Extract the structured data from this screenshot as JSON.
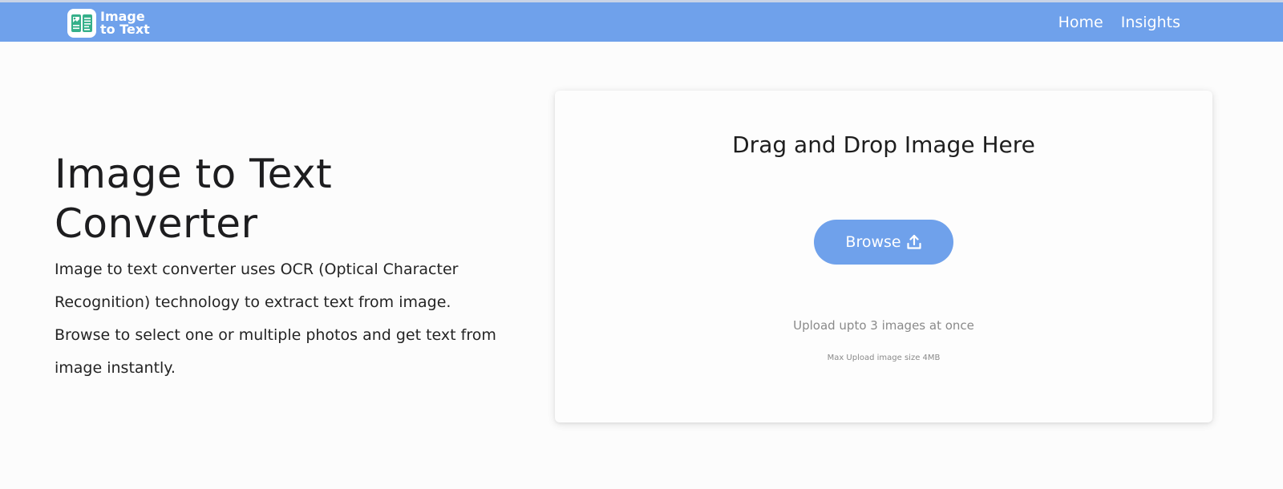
{
  "brand": {
    "line1": "Image",
    "line2": "to Text",
    "accent_color": "#6fa1eb",
    "logo_icon": "image-text-logo-icon"
  },
  "nav": {
    "links": [
      "Home",
      "Insights"
    ]
  },
  "hero": {
    "title": "Image to Text Converter",
    "description": "Image to text converter uses OCR (Optical Character Recognition) technology to extract text from image. Browse to select one or multiple photos and get text from image instantly."
  },
  "upload": {
    "title": "Drag and Drop Image Here",
    "browse_label": "Browse",
    "browse_icon": "upload-icon",
    "note": "Upload upto 3 images at once",
    "size_note": "Max Upload image size 4MB"
  }
}
